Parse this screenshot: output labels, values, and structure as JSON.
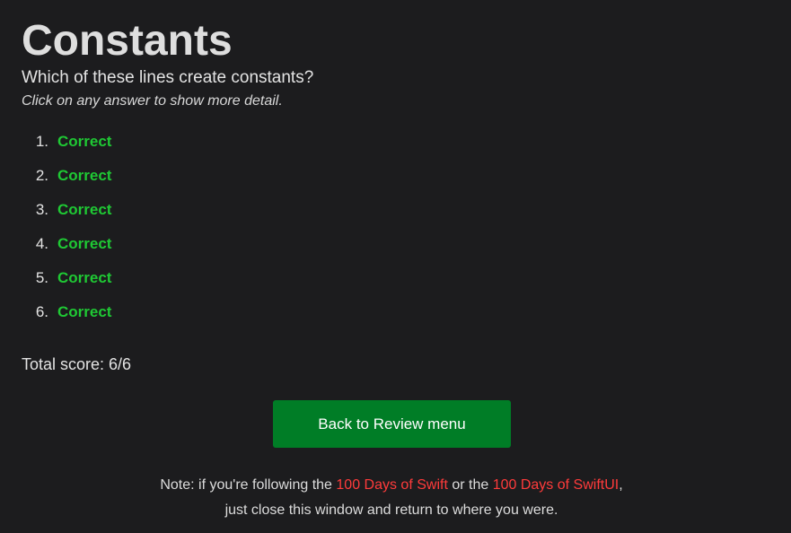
{
  "title": "Constants",
  "question": "Which of these lines create constants?",
  "hint": "Click on any answer to show more detail.",
  "answers": [
    {
      "number": "1.",
      "result": "Correct"
    },
    {
      "number": "2.",
      "result": "Correct"
    },
    {
      "number": "3.",
      "result": "Correct"
    },
    {
      "number": "4.",
      "result": "Correct"
    },
    {
      "number": "5.",
      "result": "Correct"
    },
    {
      "number": "6.",
      "result": "Correct"
    }
  ],
  "score": "Total score: 6/6",
  "back_button": "Back to Review menu",
  "note": {
    "prefix": "Note: if you're following the ",
    "link1": "100 Days of Swift",
    "middle": " or the ",
    "link2": "100 Days of SwiftUI",
    "suffix": ", just close this window and return to where you were."
  },
  "colors": {
    "correct": "#1fc934",
    "button": "#007d26",
    "link": "#ff3b3b",
    "background": "#1c1c1e"
  }
}
